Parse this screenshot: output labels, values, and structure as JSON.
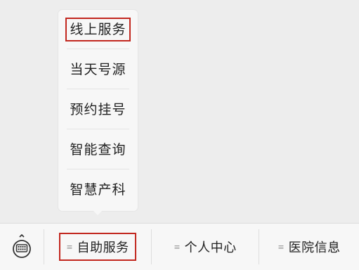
{
  "popup_menu": {
    "items": [
      {
        "label": "线上服务"
      },
      {
        "label": "当天号源"
      },
      {
        "label": "预约挂号"
      },
      {
        "label": "智能查询"
      },
      {
        "label": "智慧产科"
      }
    ]
  },
  "tabbar": {
    "menu_glyph": "≡",
    "tabs": [
      {
        "label": "自助服务"
      },
      {
        "label": "个人中心"
      },
      {
        "label": "医院信息"
      }
    ]
  },
  "colors": {
    "highlight": "#c2271f",
    "background": "#ededed",
    "bar": "#f7f7f7"
  },
  "icons": {
    "keyboard": "keyboard-icon",
    "menu": "menu-lines-icon"
  }
}
